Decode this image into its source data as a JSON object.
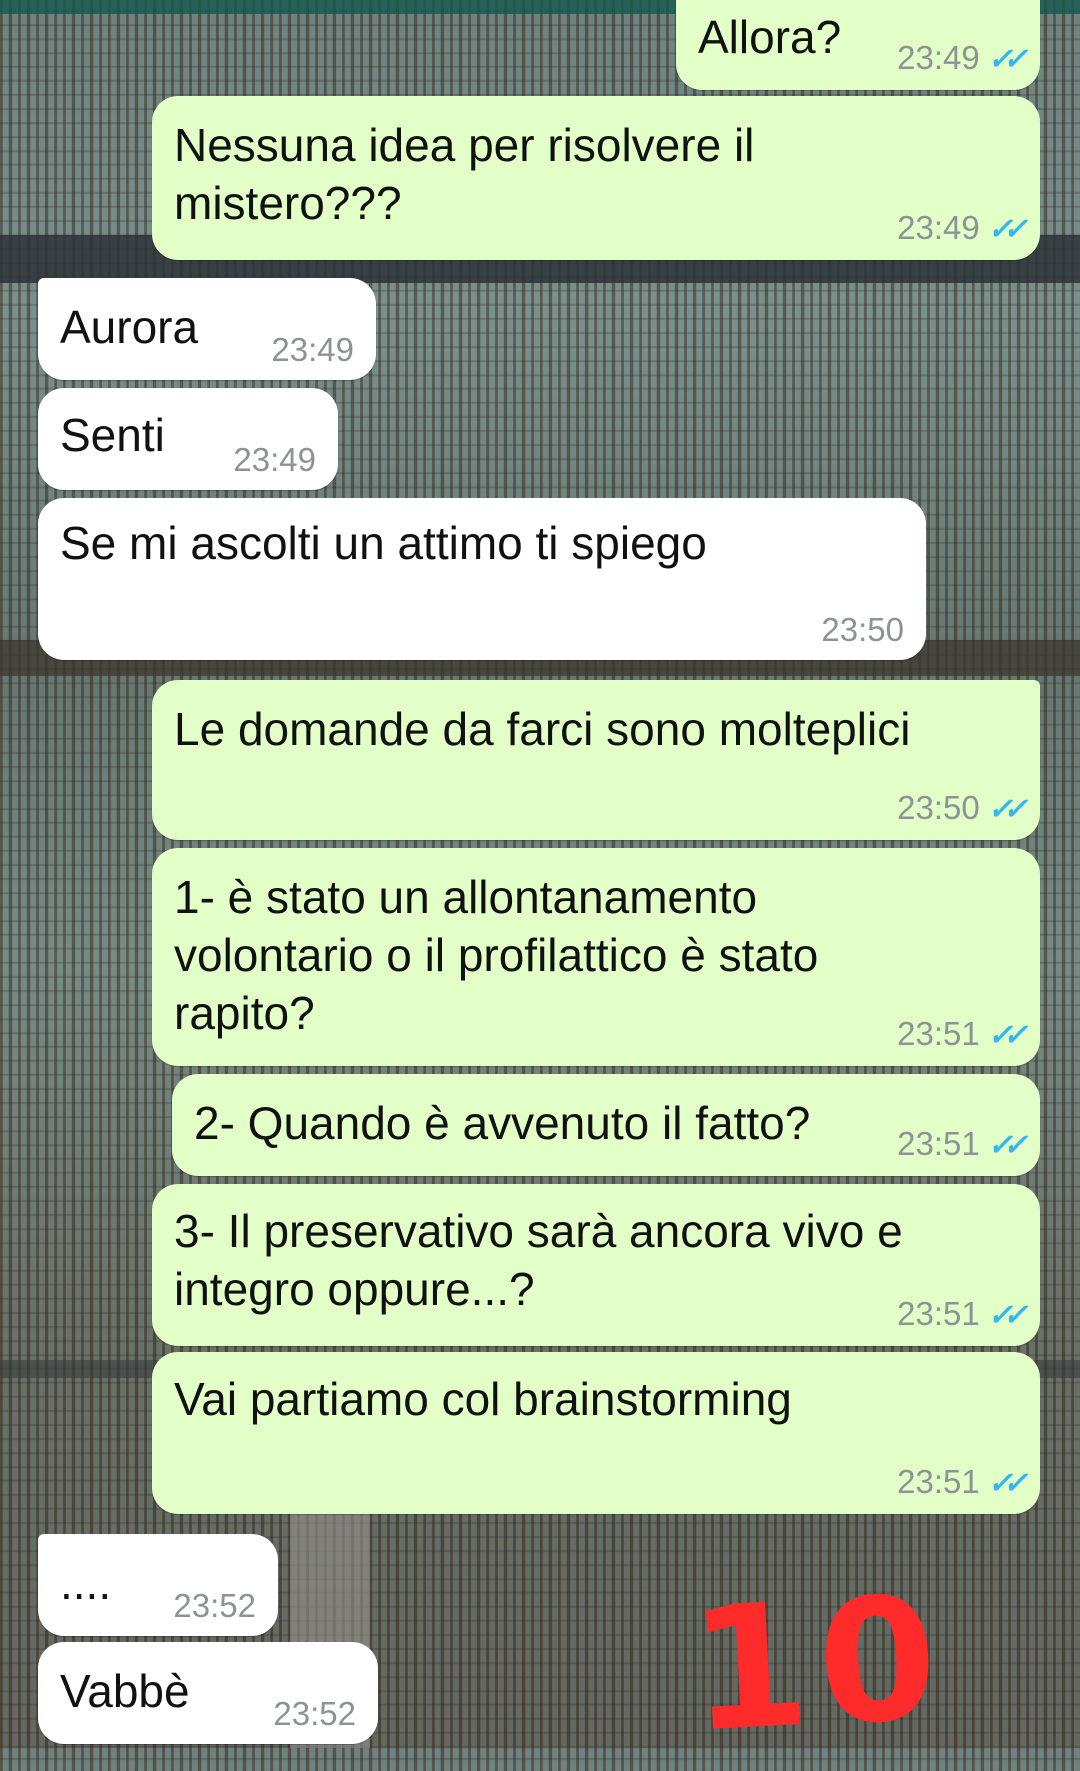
{
  "messages": [
    {
      "text": "Allora?",
      "time": "23:49",
      "direction": "out"
    },
    {
      "text": "Nessuna idea per risolvere il mistero???",
      "time": "23:49",
      "direction": "out"
    },
    {
      "text": "Aurora",
      "time": "23:49",
      "direction": "in"
    },
    {
      "text": "Senti",
      "time": "23:49",
      "direction": "in"
    },
    {
      "text": "Se mi ascolti un attimo ti spiego",
      "time": "23:50",
      "direction": "in"
    },
    {
      "text": "Le domande da farci sono molteplici",
      "time": "23:50",
      "direction": "out"
    },
    {
      "text": "1-  è stato un allontanamento volontario o il profilattico è stato rapito?",
      "time": "23:51",
      "direction": "out"
    },
    {
      "text": "2- Quando è avvenuto il fatto?",
      "time": "23:51",
      "direction": "out"
    },
    {
      "text": "3- Il preservativo sarà ancora vivo e integro oppure...?",
      "time": "23:51",
      "direction": "out"
    },
    {
      "text": "Vai partiamo col brainstorming",
      "time": "23:51",
      "direction": "out"
    },
    {
      "text": "....",
      "time": "23:52",
      "direction": "in"
    },
    {
      "text": "Vabbè",
      "time": "23:52",
      "direction": "in"
    }
  ],
  "read_receipt_icon": "double-check-icon",
  "colors": {
    "outgoing_bubble": "#e1ffc7",
    "incoming_bubble": "#ffffff",
    "timestamp": "#8c9396",
    "read_check": "#34b7f1",
    "doodle": "#ff2a2a"
  },
  "doodle_text": "10"
}
